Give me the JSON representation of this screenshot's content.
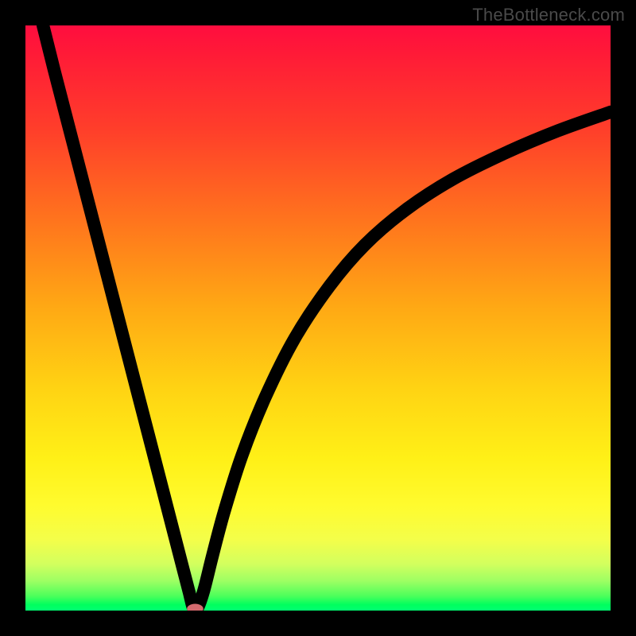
{
  "watermark": "TheBottleneck.com",
  "chart_data": {
    "type": "line",
    "title": "",
    "xlabel": "",
    "ylabel": "",
    "xlim": [
      0,
      100
    ],
    "ylim": [
      0,
      100
    ],
    "grid": false,
    "series": [
      {
        "name": "curve",
        "x": [
          3,
          5,
          8,
          11,
          14,
          17,
          20,
          23,
          25.5,
          27,
          28,
          28.7,
          29.4,
          30.5,
          32,
          34,
          37,
          41,
          46,
          52,
          58,
          65,
          73,
          82,
          91,
          100
        ],
        "values": [
          100,
          92,
          80.4,
          68.8,
          57.2,
          45.6,
          34,
          22.4,
          12.7,
          6.9,
          3.05,
          0.4,
          0.4,
          3.5,
          9.5,
          17,
          26.5,
          36.5,
          46.5,
          55.5,
          62.5,
          68.5,
          73.7,
          78.2,
          82,
          85.2
        ]
      }
    ],
    "marker": {
      "x": 29,
      "y": 0.3,
      "rx": 1.4,
      "ry": 0.85,
      "color": "#d36a6e"
    },
    "background_gradient": {
      "top": "#ff0d3f",
      "mid": "#ffd313",
      "bottom": "#00ff72"
    }
  }
}
